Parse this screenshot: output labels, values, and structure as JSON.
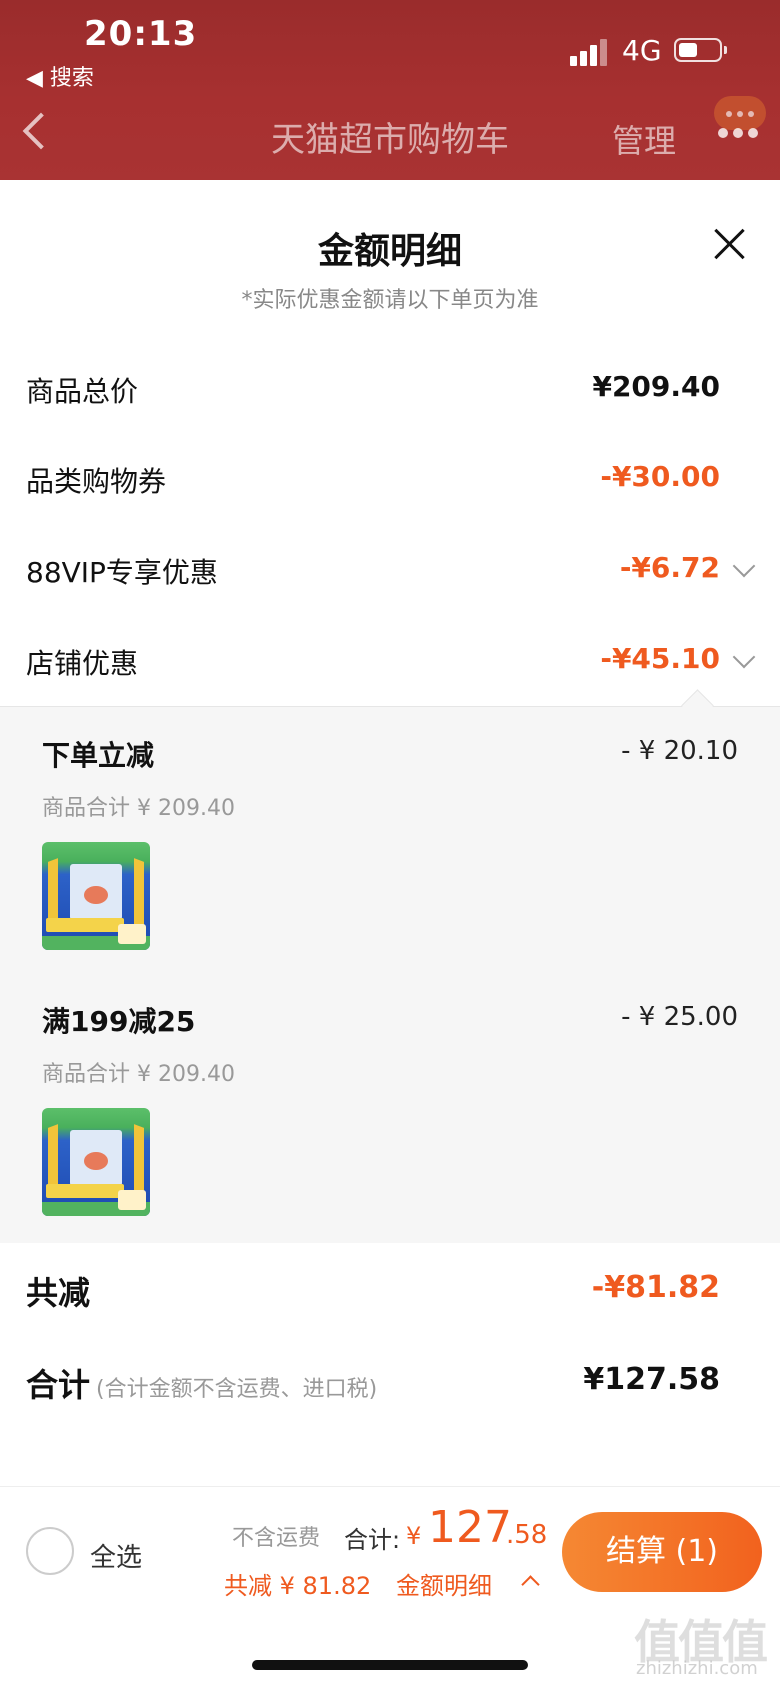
{
  "status_bar": {
    "time": "20:13",
    "back_app": "◀ 搜索",
    "network": "4G"
  },
  "nav": {
    "title": "天猫超市购物车",
    "manage": "管理"
  },
  "sheet": {
    "title": "金额明细",
    "subtitle": "*实际优惠金额请以下单页为准",
    "rows": [
      {
        "label": "商品总价",
        "value": "¥209.40"
      },
      {
        "label": "品类购物券",
        "value": "-¥30.00"
      },
      {
        "label": "88VIP专享优惠",
        "value": "-¥6.72"
      },
      {
        "label": "店铺优惠",
        "value": "-¥45.10"
      }
    ],
    "promotions": [
      {
        "name": "下单立减",
        "amount": "- ¥ 20.10",
        "subtotal": "商品合计 ¥ 209.40"
      },
      {
        "name": "满199减25",
        "amount": "- ¥ 25.00",
        "subtotal": "商品合计 ¥ 209.40"
      }
    ],
    "total_discount": {
      "label": "共减",
      "value": "-¥81.82"
    },
    "total": {
      "label": "合计",
      "note": "(合计金额不含运费、进口税)",
      "value": "¥127.58"
    }
  },
  "bottom_bar": {
    "select_all": "全选",
    "freight_note": "不含运费",
    "total_label": "合计:",
    "currency": "¥",
    "total_integer": "127",
    "total_decimal": ".58",
    "saved": "共减 ¥ 81.82",
    "detail_link": "金额明细",
    "checkout": "结算 (1)"
  },
  "watermark": {
    "logo": "值值值",
    "url": "zhizhizhi.com"
  },
  "colors": {
    "header": "#a73030",
    "accent": "#ef5a1f",
    "checkout": "#f2621e"
  }
}
